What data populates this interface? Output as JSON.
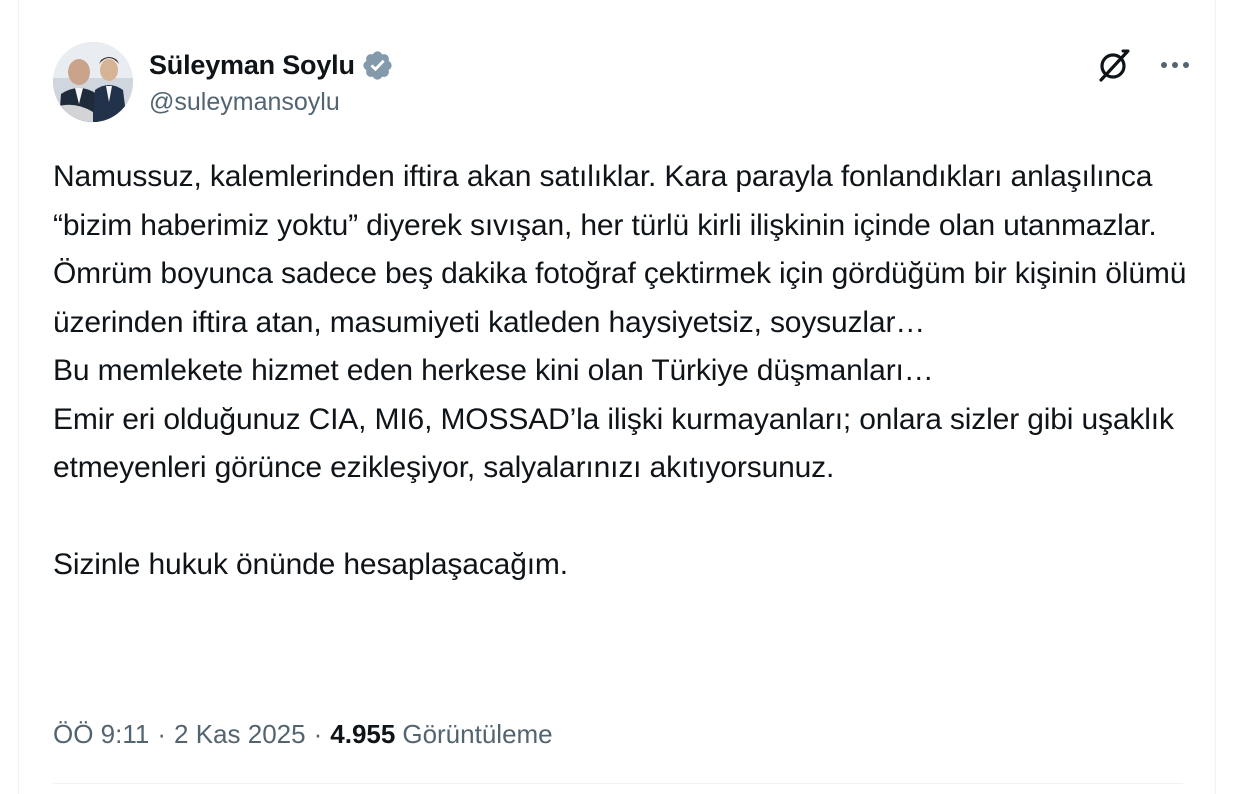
{
  "author": {
    "display_name": "Süleyman Soylu",
    "handle": "@suleymansoylu",
    "verified_color": "#829aab"
  },
  "icons": {
    "verified": "verified-badge-icon",
    "grok": "grok-icon",
    "more": "more-options-icon"
  },
  "tweet": {
    "text": "Namussuz, kalemlerinden iftira akan satılıklar. Kara parayla fonlandıkları anlaşılınca “bizim haberimiz yoktu” diyerek sıvışan, her türlü kirli ilişkinin içinde olan utanmazlar.\nÖmrüm boyunca sadece beş dakika fotoğraf çektirmek için gördüğüm bir kişinin ölümü üzerinden iftira atan, masumiyeti katleden haysiyetsiz, soysuzlar…\nBu memlekete hizmet eden herkese kini olan Türkiye düşmanları…\nEmir eri olduğunuz CIA, MI6, MOSSAD’la ilişki kurmayanları; onlara sizler gibi uşaklık etmeyenleri görünce ezikleşiyor, salyalarınızı akıtıyorsunuz.\n\nSizinle hukuk önünde hesaplaşacağım."
  },
  "meta": {
    "time": "ÖÖ 9:11",
    "separator": "·",
    "date": "2 Kas 2025",
    "views_count": "4.955",
    "views_label": "Görüntüleme"
  },
  "colors": {
    "text_primary": "#0f1419",
    "text_secondary": "#536471",
    "divider": "#eff3f4"
  }
}
